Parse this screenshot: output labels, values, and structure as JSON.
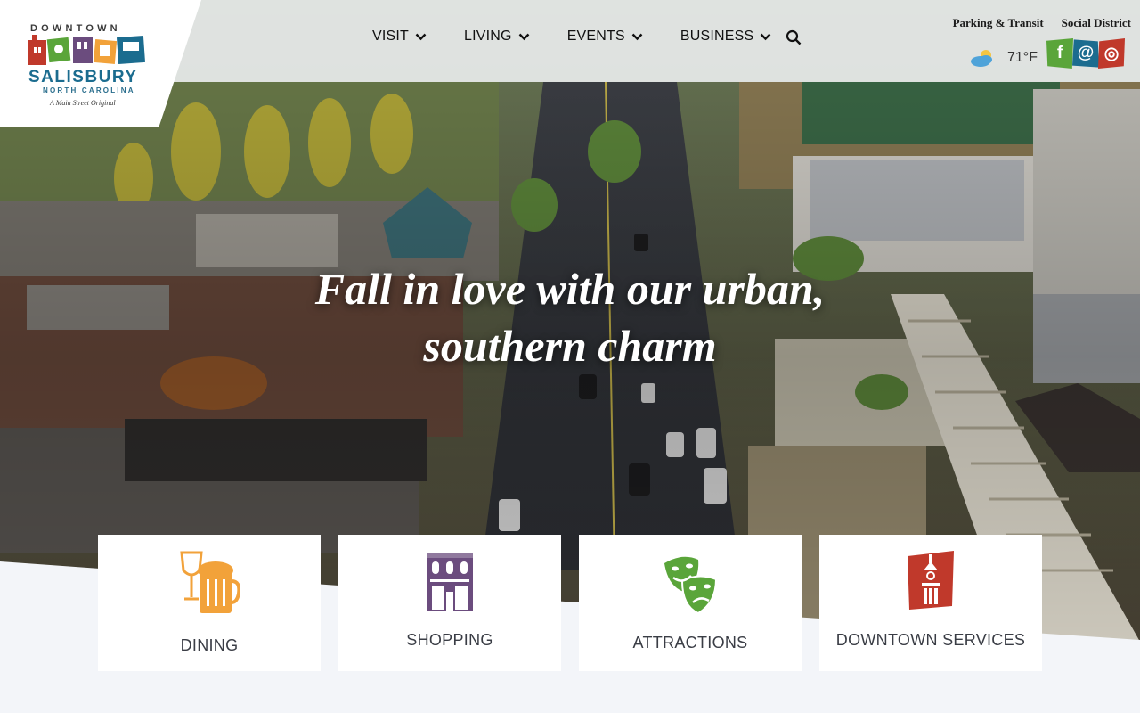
{
  "logo": {
    "top": "DOWNTOWN",
    "main": "SALISBURY",
    "sub": "NORTH CAROLINA",
    "tagline": "A Main Street Original"
  },
  "nav": {
    "items": [
      {
        "label": "VISIT"
      },
      {
        "label": "LIVING"
      },
      {
        "label": "EVENTS"
      },
      {
        "label": "BUSINESS"
      }
    ],
    "search_icon": "search-icon"
  },
  "utility": {
    "links": [
      {
        "label": "Parking & Transit"
      },
      {
        "label": "Social District"
      }
    ]
  },
  "weather": {
    "icon": "partly-cloudy-icon",
    "temperature": "71°F"
  },
  "social": [
    {
      "icon": "facebook-icon",
      "glyph": "f",
      "color": "#5aa53a"
    },
    {
      "icon": "threads-icon",
      "glyph": "@",
      "color": "#1b6c8f"
    },
    {
      "icon": "instagram-icon",
      "glyph": "◎",
      "color": "#c0392b"
    }
  ],
  "hero": {
    "line1": "Fall in love with our urban,",
    "line2": "southern charm"
  },
  "cards": [
    {
      "label": "DINING",
      "icon": "wine-beer-icon",
      "color": "#f2a23a"
    },
    {
      "label": "SHOPPING",
      "icon": "storefront-icon",
      "color": "#6b4c7e"
    },
    {
      "label": "ATTRACTIONS",
      "icon": "theater-masks-icon",
      "color": "#5aa53a"
    },
    {
      "label": "DOWNTOWN SERVICES",
      "icon": "clock-tower-icon",
      "color": "#c0392b"
    }
  ]
}
